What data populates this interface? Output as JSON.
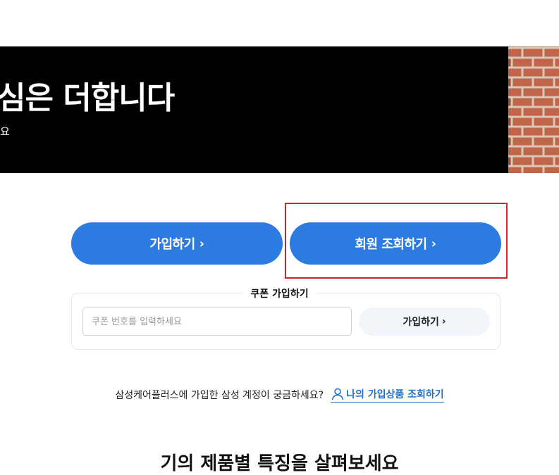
{
  "banner": {
    "title": "심은 더합니다",
    "subtitle": "요"
  },
  "actions": {
    "join_label": "가입하기",
    "lookup_label": "회원 조회하기"
  },
  "coupon": {
    "title": "쿠폰 가입하기",
    "placeholder": "쿠폰 번호를 입력하세요",
    "value": "",
    "button_label": "가입하기"
  },
  "help": {
    "question": "삼성케어플러스에 가입한 삼성 계정이 궁금하세요?",
    "link_label": "나의 가입상품 조회하기"
  },
  "next_section": {
    "heading": "기의 제품별 특징을 살펴보세요"
  },
  "colors": {
    "primary": "#2c7be0",
    "highlight": "#d3222a",
    "link": "#1f6fd1"
  }
}
